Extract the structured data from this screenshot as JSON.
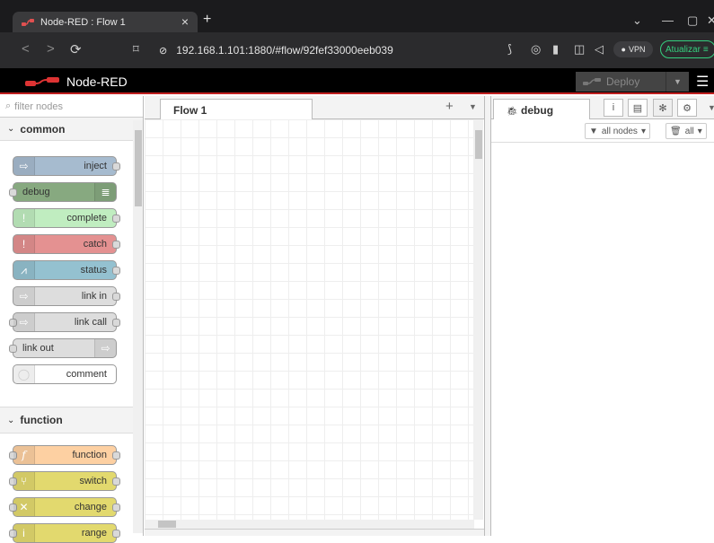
{
  "browser": {
    "tab_title": "Node-RED : Flow 1",
    "url": "192.168.1.101:1880/#flow/92fef33000eeb039",
    "vpn_label": "VPN",
    "update_label": "Atualizar"
  },
  "header": {
    "app_name": "Node-RED",
    "deploy_label": "Deploy"
  },
  "palette": {
    "filter_placeholder": "filter nodes",
    "categories": [
      {
        "label": "common",
        "nodes": [
          {
            "label": "inject",
            "color": "#a6bbcf",
            "icon": "arrow-icon"
          },
          {
            "label": "debug",
            "color": "#87a980",
            "icon": "list-icon"
          },
          {
            "label": "complete",
            "color": "#c0edc0",
            "icon": "exclamation-icon"
          },
          {
            "label": "catch",
            "color": "#e49191",
            "icon": "exclamation-icon"
          },
          {
            "label": "status",
            "color": "#94c1d0",
            "icon": "pulse-icon"
          },
          {
            "label": "link in",
            "color": "#dddddd",
            "icon": "link-icon"
          },
          {
            "label": "link call",
            "color": "#dddddd",
            "icon": "link-icon"
          },
          {
            "label": "link out",
            "color": "#dddddd",
            "icon": "link-icon"
          },
          {
            "label": "comment",
            "color": "#ffffff",
            "icon": "comment-icon"
          }
        ]
      },
      {
        "label": "function",
        "nodes": [
          {
            "label": "function",
            "color": "#fdd0a2",
            "icon": "function-icon"
          },
          {
            "label": "switch",
            "color": "#e2d96e",
            "icon": "switch-icon"
          },
          {
            "label": "change",
            "color": "#e2d96e",
            "icon": "change-icon"
          },
          {
            "label": "range",
            "color": "#e2d96e",
            "icon": "range-icon"
          }
        ]
      }
    ]
  },
  "workspace": {
    "tab_label": "Flow 1"
  },
  "sidebar": {
    "tab_label": "debug",
    "filter_nodes_label": "all nodes",
    "clear_label": "all"
  }
}
